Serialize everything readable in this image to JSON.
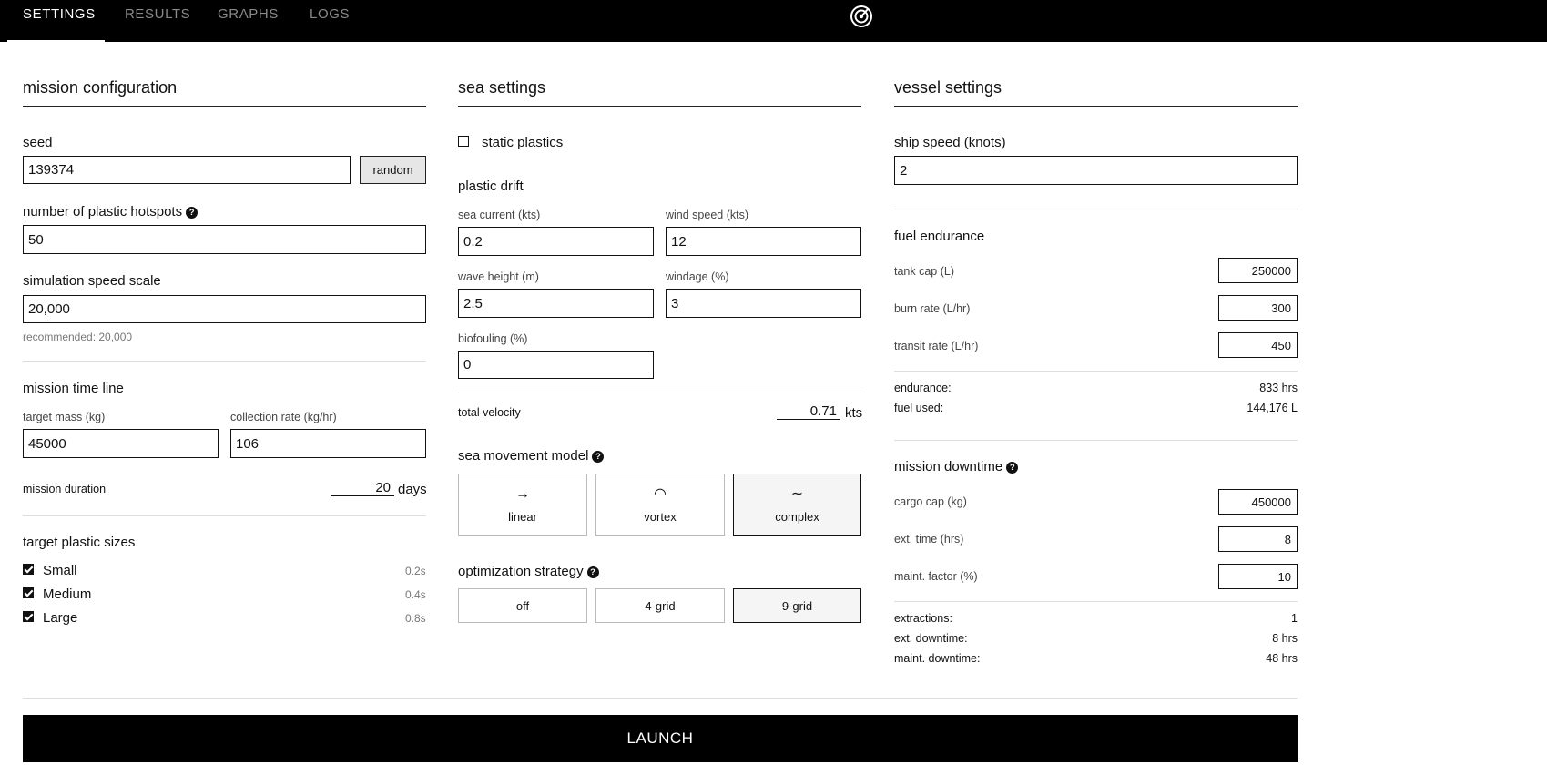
{
  "nav": {
    "tabs": [
      {
        "label": "SETTINGS",
        "active": true
      },
      {
        "label": "RESULTS",
        "active": false
      },
      {
        "label": "GRAPHS",
        "active": false
      },
      {
        "label": "LOGS",
        "active": false
      }
    ],
    "logo_icon": "target-icon"
  },
  "mission": {
    "title": "mission configuration",
    "seed_label": "seed",
    "seed_value": "139374",
    "random_label": "random",
    "hotspots_label": "number of plastic hotspots",
    "hotspots_value": "50",
    "speed_scale_label": "simulation speed scale",
    "speed_scale_value": "20,000",
    "recommended": "recommended: 20,000",
    "timeline_title": "mission time line",
    "target_mass_label": "target mass (kg)",
    "target_mass_value": "45000",
    "collection_rate_label": "collection rate (kg/hr)",
    "collection_rate_value": "106",
    "duration_label": "mission duration",
    "duration_value": "20",
    "duration_unit": "days",
    "sizes_title": "target plastic sizes",
    "sizes": [
      {
        "label": "Small",
        "value": "0.2s",
        "checked": true
      },
      {
        "label": "Medium",
        "value": "0.4s",
        "checked": true
      },
      {
        "label": "Large",
        "value": "0.8s",
        "checked": true
      }
    ]
  },
  "sea": {
    "title": "sea settings",
    "static_label": "static plastics",
    "static_checked": false,
    "drift_title": "plastic drift",
    "current_label": "sea current (kts)",
    "current_value": "0.2",
    "wind_label": "wind speed (kts)",
    "wind_value": "12",
    "wave_label": "wave height (m)",
    "wave_value": "2.5",
    "windage_label": "windage (%)",
    "windage_value": "3",
    "biofouling_label": "biofouling (%)",
    "biofouling_value": "0",
    "total_velocity_label": "total velocity",
    "total_velocity_value": "0.71",
    "total_velocity_unit": "kts",
    "movement_title": "sea movement model",
    "movement": [
      {
        "label": "linear",
        "icon": "→",
        "selected": false
      },
      {
        "label": "vortex",
        "icon": "◠",
        "selected": false
      },
      {
        "label": "complex",
        "icon": "∼",
        "selected": true
      }
    ],
    "optimization_title": "optimization strategy",
    "optimization": [
      {
        "label": "off",
        "selected": false
      },
      {
        "label": "4-grid",
        "selected": false
      },
      {
        "label": "9-grid",
        "selected": true
      }
    ]
  },
  "vessel": {
    "title": "vessel settings",
    "speed_label": "ship speed (knots)",
    "speed_value": "2",
    "fuel_title": "fuel endurance",
    "tank_label": "tank cap (L)",
    "tank_value": "250000",
    "burn_label": "burn rate (L/hr)",
    "burn_value": "300",
    "transit_label": "transit rate (L/hr)",
    "transit_value": "450",
    "endurance_label": "endurance:",
    "endurance_value": "833 hrs",
    "fuel_used_label": "fuel used:",
    "fuel_used_value": "144,176 L",
    "downtime_title": "mission downtime",
    "cargo_label": "cargo cap (kg)",
    "cargo_value": "450000",
    "ext_time_label": "ext. time (hrs)",
    "ext_time_value": "8",
    "maint_label": "maint. factor (%)",
    "maint_value": "10",
    "extractions_label": "extractions:",
    "extractions_value": "1",
    "ext_downtime_label": "ext. downtime:",
    "ext_downtime_value": "8 hrs",
    "maint_downtime_label": "maint. downtime:",
    "maint_downtime_value": "48 hrs"
  },
  "launch_label": "LAUNCH"
}
